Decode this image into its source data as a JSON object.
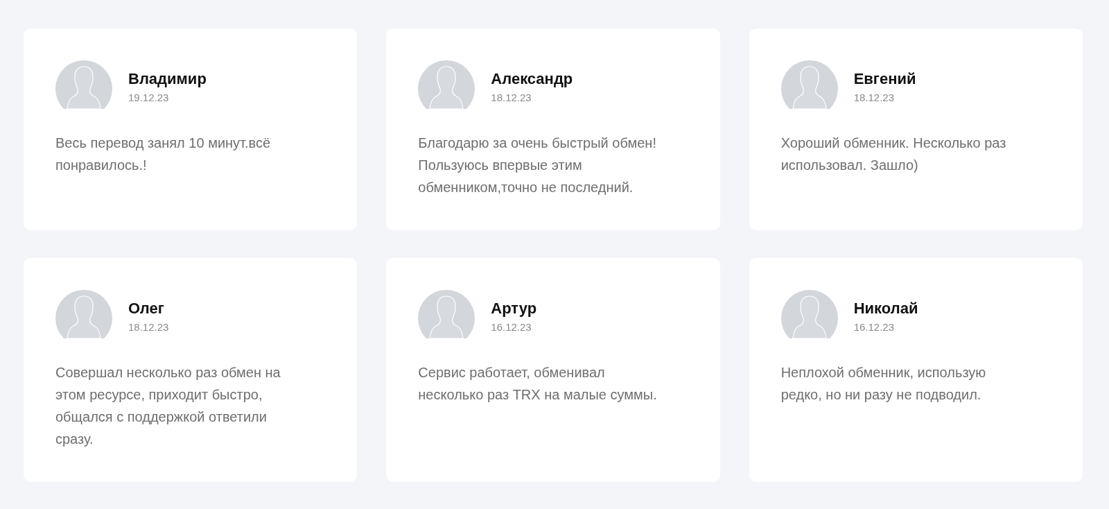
{
  "reviews": [
    {
      "name": "Владимир",
      "date": "19.12.23",
      "text": "Весь перевод занял 10 минут.всё понравилось.!"
    },
    {
      "name": "Александр",
      "date": "18.12.23",
      "text": "Благодарю за очень быстрый обмен! Пользуюсь впервые этим обменником,точно не последний."
    },
    {
      "name": "Евгений",
      "date": "18.12.23",
      "text": "Хороший обменник. Несколько раз использовал. Зашло)"
    },
    {
      "name": "Олег",
      "date": "18.12.23",
      "text": "Совершал несколько раз обмен на этом ресурсе, приходит быстро, общался с поддержкой ответили сразу."
    },
    {
      "name": "Артур",
      "date": "16.12.23",
      "text": "Сервис работает, обменивал несколько раз TRX на малые суммы."
    },
    {
      "name": "Николай",
      "date": "16.12.23",
      "text": "Неплохой обменник, использую редко, но ни разу не подводил."
    }
  ]
}
